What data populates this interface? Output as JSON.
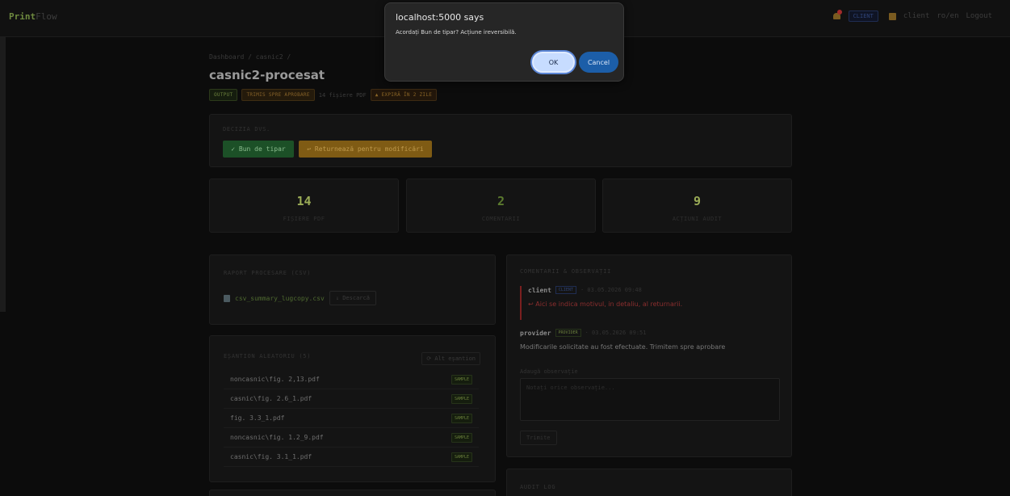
{
  "app": {
    "logo_a": "Print",
    "logo_b": "Flow"
  },
  "topbar": {
    "notif_count": "1",
    "role_badge": "CLIENT",
    "username": "client",
    "lang": "ro/en",
    "logout": "Logout"
  },
  "page": {
    "breadcrumb": "Dashboard / casnic2 /",
    "title": "casnic2-procesat",
    "badges": {
      "output": "OUTPUT",
      "status": "TRIMIS SPRE APROBARE",
      "files": "14 fișiere PDF",
      "expires": "▲ EXPIRĂ ÎN 2 ZILE"
    }
  },
  "decision": {
    "title": "DECIZIA DVS.",
    "approve": "✓ Bun de tipar",
    "return": "↩ Returnează pentru modificări"
  },
  "stats": [
    {
      "value": "14",
      "label": "FIȘIERE PDF",
      "color": "#9aab56"
    },
    {
      "value": "2",
      "label": "COMENTARII",
      "color": "#5b7a2e"
    },
    {
      "value": "9",
      "label": "ACȚIUNI AUDIT",
      "color": "#9aab56"
    }
  ],
  "report": {
    "title": "RAPORT PROCESARE (CSV)",
    "file": "csv_summary_lugcopy.csv",
    "download": "↓ Descarcă"
  },
  "samples": {
    "title": "EȘANTION ALEATORIU (5)",
    "other": "⟳ Alt eșantion",
    "tag": "SAMPLE",
    "items": [
      "noncasnic\\fig. 2,13.pdf",
      "casnic\\fig. 2.6_1.pdf",
      "fig. 3.3_1.pdf",
      "noncasnic\\fig. 1.2_9.pdf",
      "casnic\\fig. 3.1_1.pdf"
    ]
  },
  "comments": {
    "title": "COMENTARII & OBSERVAȚII",
    "items": [
      {
        "user": "client",
        "role": "CLIENT",
        "time": "· 03.05.2026 09:48",
        "text": "↩ Aici se indica motivul, in detaliu, al returnarii."
      },
      {
        "user": "provider",
        "role": "PROVIDER",
        "time": "· 03.05.2026 09:51",
        "text": "Modificarile solicitate au fost efectuate. Trimitem spre aprobare"
      }
    ],
    "add_label": "Adaugă observație",
    "placeholder": "Notați orice observație...",
    "send": "Trimite"
  },
  "audit": {
    "title": "AUDIT LOG"
  },
  "dialog": {
    "title": "localhost:5000 says",
    "message": "Acordați Bun de tipar? Acțiune ireversibilă.",
    "ok": "OK",
    "cancel": "Cancel"
  }
}
